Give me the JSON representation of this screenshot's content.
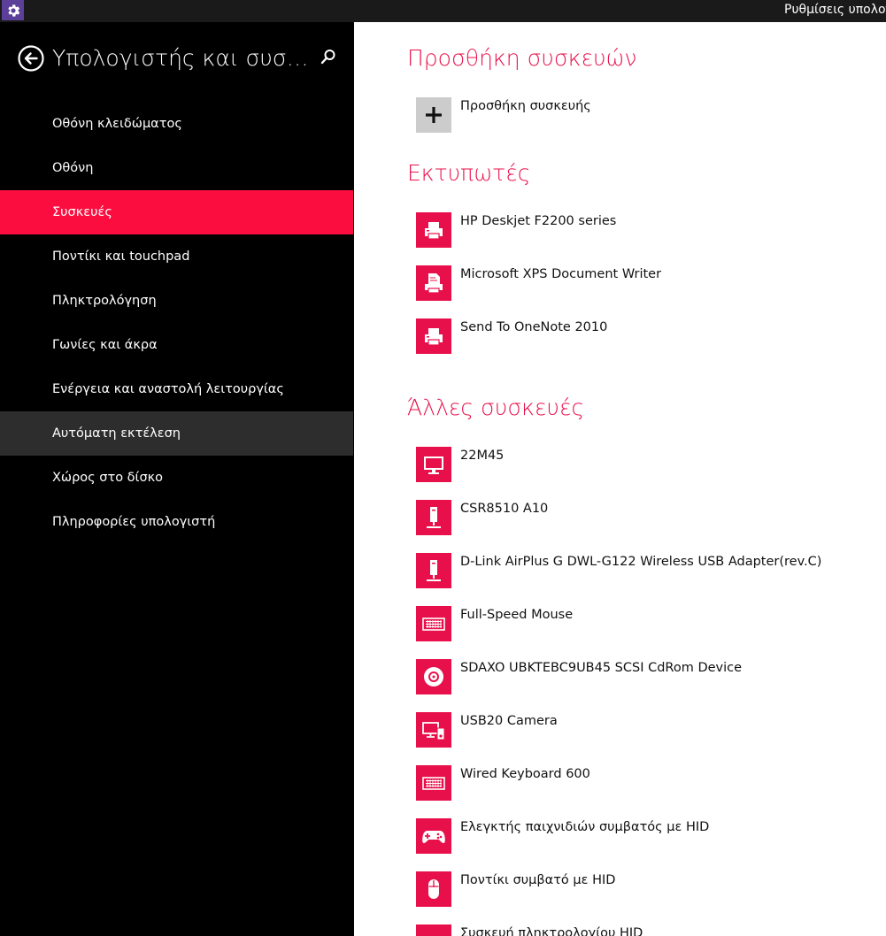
{
  "window": {
    "title": "Ρυθμίσεις υπολογ",
    "app_icon": "gear-icon",
    "accent": "#5b3f99"
  },
  "sidebar": {
    "title": "Υπολογιστής και συσκευές",
    "back_icon": "back-arrow-icon",
    "search_icon": "search-icon",
    "items": [
      {
        "label": "Οθόνη κλειδώματος",
        "state": "normal"
      },
      {
        "label": "Οθόνη",
        "state": "normal"
      },
      {
        "label": "Συσκευές",
        "state": "selected"
      },
      {
        "label": "Ποντίκι και touchpad",
        "state": "normal"
      },
      {
        "label": "Πληκτρολόγηση",
        "state": "normal"
      },
      {
        "label": "Γωνίες και άκρα",
        "state": "normal"
      },
      {
        "label": "Ενέργεια και αναστολή λειτουργίας",
        "state": "normal"
      },
      {
        "label": "Αυτόματη εκτέλεση",
        "state": "hover"
      },
      {
        "label": "Χώρος στο δίσκο",
        "state": "normal"
      },
      {
        "label": "Πληροφορίες υπολογιστή",
        "state": "normal"
      }
    ]
  },
  "colors": {
    "accent": "#e8104a",
    "selected": "#fb0e3f",
    "sidebar_bg": "#000000",
    "hover_bg": "#2d2d2d"
  },
  "main": {
    "add_section": {
      "title": "Προσθήκη συσκευών",
      "add_label": "Προσθήκη συσκευής",
      "add_icon": "plus-icon"
    },
    "printers": {
      "title": "Εκτυπωτές",
      "items": [
        {
          "label": "HP Deskjet F2200 series",
          "icon": "printer-icon"
        },
        {
          "label": "Microsoft XPS Document Writer",
          "icon": "document-printer-icon"
        },
        {
          "label": "Send To OneNote 2010",
          "icon": "printer-icon"
        }
      ]
    },
    "other_devices": {
      "title": "Άλλες συσκευές",
      "items": [
        {
          "label": "22M45",
          "icon": "monitor-icon"
        },
        {
          "label": "CSR8510 A10",
          "icon": "usb-device-icon"
        },
        {
          "label": "D-Link AirPlus G DWL-G122 Wireless USB Adapter(rev.C)",
          "icon": "usb-device-icon"
        },
        {
          "label": "Full-Speed Mouse",
          "icon": "keyboard-icon"
        },
        {
          "label": "SDAXO UBKTEBC9UB45 SCSI CdRom Device",
          "icon": "disc-icon"
        },
        {
          "label": "USB20 Camera",
          "icon": "multimedia-device-icon"
        },
        {
          "label": "Wired Keyboard 600",
          "icon": "keyboard-icon"
        },
        {
          "label": "Ελεγκτής παιχνιδιών συμβατός με HID",
          "icon": "gamepad-icon"
        },
        {
          "label": "Ποντίκι συμβατό με HID",
          "icon": "mouse-icon"
        },
        {
          "label": "Συσκευή πληκτρολογίου HID",
          "icon": "keyboard-icon"
        }
      ]
    }
  }
}
